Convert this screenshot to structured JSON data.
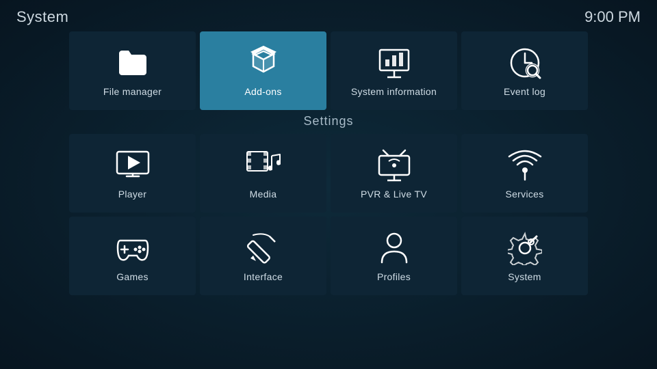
{
  "header": {
    "title": "System",
    "time": "9:00 PM"
  },
  "top_row": [
    {
      "id": "file-manager",
      "label": "File manager",
      "icon": "folder"
    },
    {
      "id": "add-ons",
      "label": "Add-ons",
      "icon": "addons",
      "active": true
    },
    {
      "id": "system-information",
      "label": "System information",
      "icon": "sysinfo"
    },
    {
      "id": "event-log",
      "label": "Event log",
      "icon": "eventlog"
    }
  ],
  "settings": {
    "title": "Settings",
    "items": [
      {
        "id": "player",
        "label": "Player",
        "icon": "player"
      },
      {
        "id": "media",
        "label": "Media",
        "icon": "media"
      },
      {
        "id": "pvr-live-tv",
        "label": "PVR & Live TV",
        "icon": "pvr"
      },
      {
        "id": "services",
        "label": "Services",
        "icon": "services"
      },
      {
        "id": "games",
        "label": "Games",
        "icon": "games"
      },
      {
        "id": "interface",
        "label": "Interface",
        "icon": "interface"
      },
      {
        "id": "profiles",
        "label": "Profiles",
        "icon": "profiles"
      },
      {
        "id": "system",
        "label": "System",
        "icon": "system"
      }
    ]
  }
}
